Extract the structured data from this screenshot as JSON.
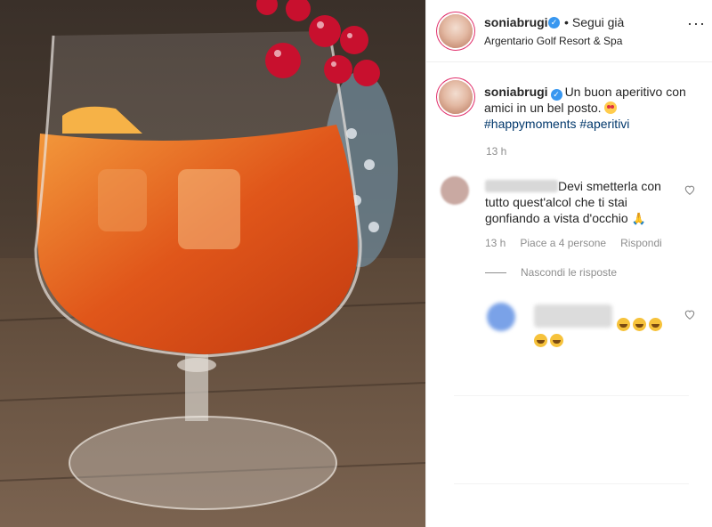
{
  "post_header": {
    "username": "soniabrugi",
    "follow_label": "Segui già",
    "location": "Argentario Golf Resort & Spa"
  },
  "caption": {
    "username": "soniabrugi",
    "text": "Un buon aperitivo con amici in un bel posto.",
    "hashtags": "#happymoments #aperitivi",
    "time": "13 h",
    "emoji": "heart-eyes-emoji"
  },
  "comments": [
    {
      "text": "Devi smetterla con tutto quest'alcol che ti stai gonfiando a vista d'occhio",
      "emoji": "pray-emoji",
      "time": "13 h",
      "likes": "Piace a 4 persone",
      "reply_label": "Rispondi"
    }
  ],
  "hide_replies_label": "Nascondi le risposte",
  "colors": {
    "verified": "#3897f0",
    "hashtag": "#00376b",
    "meta_text": "#8e8e8e",
    "drink": "#e0561a"
  }
}
